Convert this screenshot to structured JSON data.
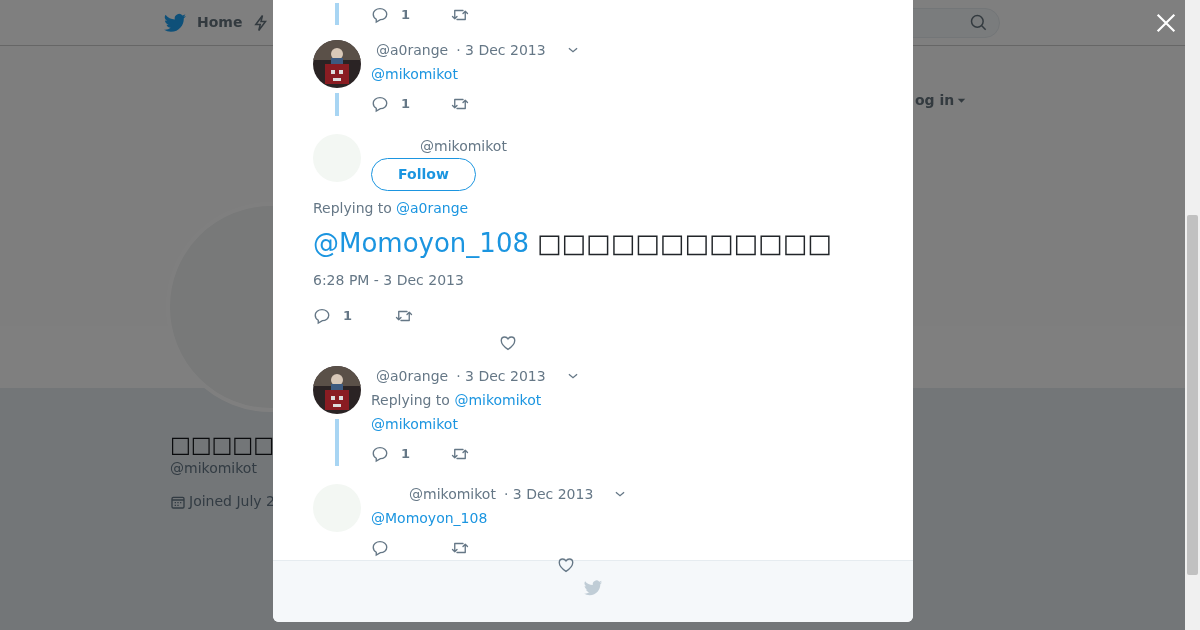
{
  "navbar": {
    "home": "Home",
    "login": "og in"
  },
  "profile": {
    "name": "□□□□□",
    "handle": "@mikomikot",
    "joined": "Joined July 2"
  },
  "tweets": [
    {
      "kind": "fragment",
      "reply_count": "1",
      "thread": true,
      "like_icon": false
    },
    {
      "kind": "reply",
      "handle": "@a0range",
      "date": "· 3 Dec 2013",
      "mention": "@mikomikot",
      "reply_count": "1",
      "thread": true,
      "like_icon": false
    },
    {
      "kind": "main",
      "handle": "@mikomikot",
      "follow": "Follow",
      "replying_label": "Replying to",
      "replying_to": "@a0range",
      "mention": "@Momoyon_108",
      "text": "□□□□□□□□□□□□",
      "timestamp": "6:28 PM - 3 Dec 2013",
      "reply_count": "1",
      "like_icon": true
    },
    {
      "kind": "reply",
      "handle": "@a0range",
      "date": "· 3 Dec 2013",
      "replying_label": "Replying to",
      "replying_to": "@mikomikot",
      "mention": "@mikomikot",
      "reply_count": "1",
      "thread": true,
      "like_icon": false
    },
    {
      "kind": "reply",
      "handle": "@mikomikot",
      "date": "· 3 Dec 2013",
      "mention": "@Momoyon_108",
      "thread": false,
      "like_icon": true
    }
  ]
}
